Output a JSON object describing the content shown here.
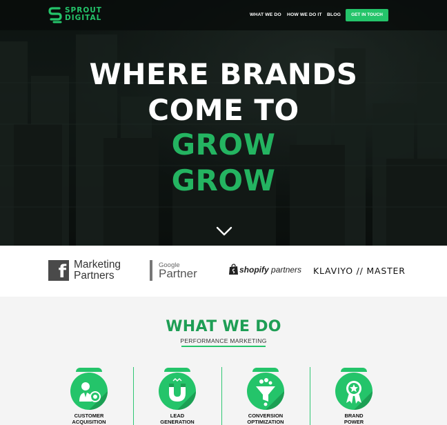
{
  "brand": {
    "logo_line1": "SPROUT",
    "logo_line2": "DIGITAL",
    "accent": "#24c46a",
    "accent_dark": "#1e9e55"
  },
  "nav": {
    "items": [
      {
        "label": "WHAT WE DO"
      },
      {
        "label": "HOW WE DO IT"
      },
      {
        "label": "BLOG"
      }
    ],
    "cta_label": "GET IN TOUCH"
  },
  "hero": {
    "line1": "WHERE BRANDS",
    "line2": "COME TO",
    "line3": "GROW",
    "line4": "GROW",
    "scroll_icon": "chevron-down-icon"
  },
  "partners": {
    "facebook": {
      "icon_letter": "f",
      "line1": "Marketing",
      "line2": "Partners"
    },
    "google": {
      "small": "Google",
      "big": "Partner"
    },
    "shopify": {
      "bold": "shopify",
      "rest": "partners"
    },
    "klaviyo": {
      "label": "KLAVIYO // MASTER"
    }
  },
  "what_we_do": {
    "title": "WHAT WE DO",
    "subtitle": "PERFORMANCE MARKETING",
    "services": [
      {
        "label_line1": "CUSTOMER",
        "label_line2": "ACQUISITION",
        "icon": "person-target-icon"
      },
      {
        "label_line1": "LEAD",
        "label_line2": "GENERATION",
        "icon": "magnet-icon"
      },
      {
        "label_line1": "CONVERSION",
        "label_line2": "OPTIMIZATION",
        "icon": "funnel-icon"
      },
      {
        "label_line1": "BRAND",
        "label_line2": "POWER",
        "icon": "star-badge-icon"
      }
    ]
  }
}
